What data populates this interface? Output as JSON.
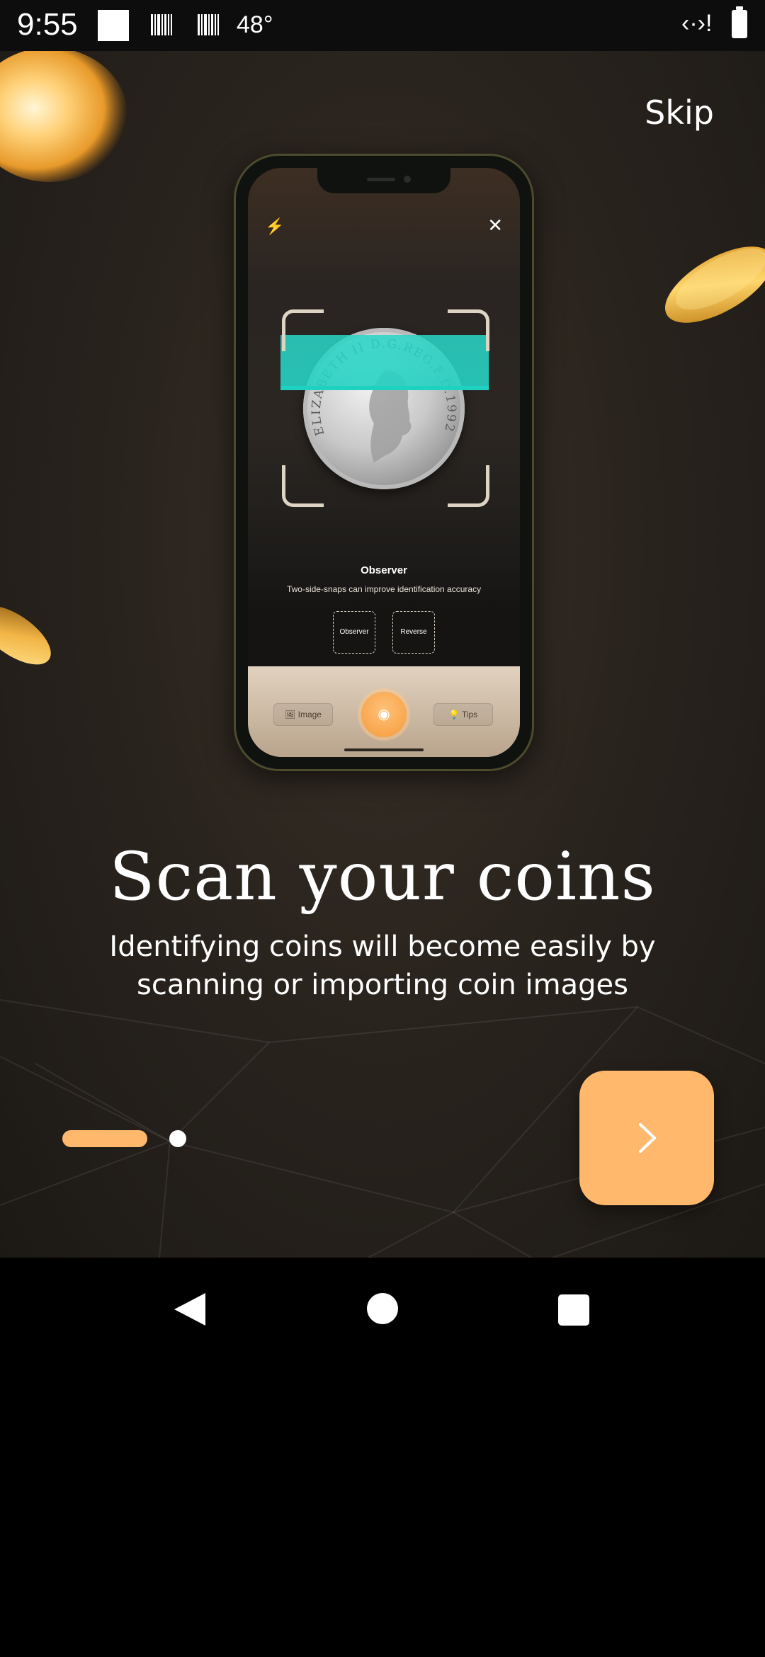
{
  "status_bar": {
    "time": "9:55",
    "temperature": "48°",
    "network_icon": "‹·›!"
  },
  "onboarding": {
    "skip_label": "Skip",
    "headline": "Scan your coins",
    "subtitle": "Identifying coins will become easily by scanning or importing coin images",
    "page_index": 1,
    "page_count": 2,
    "accent_color": "#ffb86c"
  },
  "phone_mockup": {
    "side_title": "Observer",
    "hint_text": "Two-side-snaps can improve identification accuracy",
    "observer_label": "Observer",
    "reverse_label": "Reverse",
    "image_button_label": "Image",
    "tips_button_label": "Tips",
    "scan_color": "#1fd1c1",
    "coin_text": "ELIZABETH II D.G.REG.F.D.1992"
  },
  "nav": {
    "back_icon": "back-triangle",
    "home_icon": "home-circle",
    "recent_icon": "recent-square"
  }
}
